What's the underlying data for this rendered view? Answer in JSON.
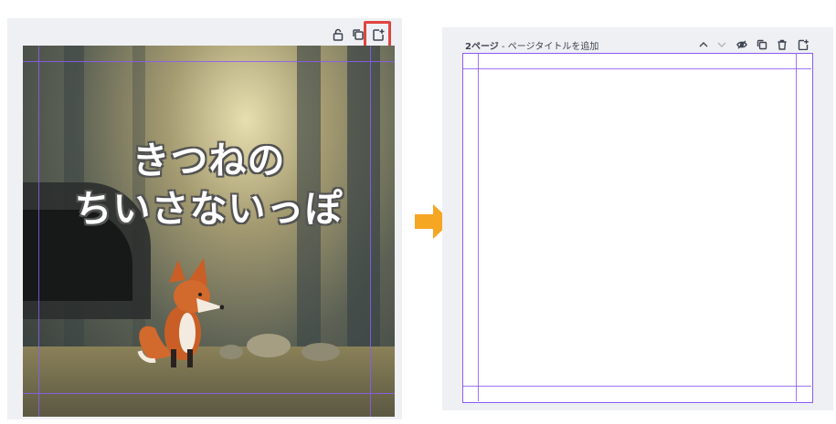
{
  "left_panel": {
    "toolbar": {
      "lock_icon": "lock-icon",
      "duplicate_icon": "duplicate-icon",
      "add_page_icon": "add-page-icon"
    },
    "canvas": {
      "title_line1": "きつねの",
      "title_line2": "ちいさないっぽ"
    }
  },
  "arrow": {
    "color": "#f5a623"
  },
  "right_panel": {
    "header": {
      "page_number": "2ページ",
      "separator": " - ",
      "title_placeholder": "ページタイトルを追加"
    },
    "toolbar": {
      "up_icon": "chevron-up-icon",
      "down_icon": "chevron-down-icon",
      "hide_icon": "eye-off-icon",
      "duplicate_icon": "duplicate-icon",
      "delete_icon": "trash-icon",
      "add_page_icon": "add-page-icon"
    }
  },
  "colors": {
    "panel_bg": "#eef0f3",
    "guide": "#8b5cf6",
    "highlight": "#e0453f"
  }
}
